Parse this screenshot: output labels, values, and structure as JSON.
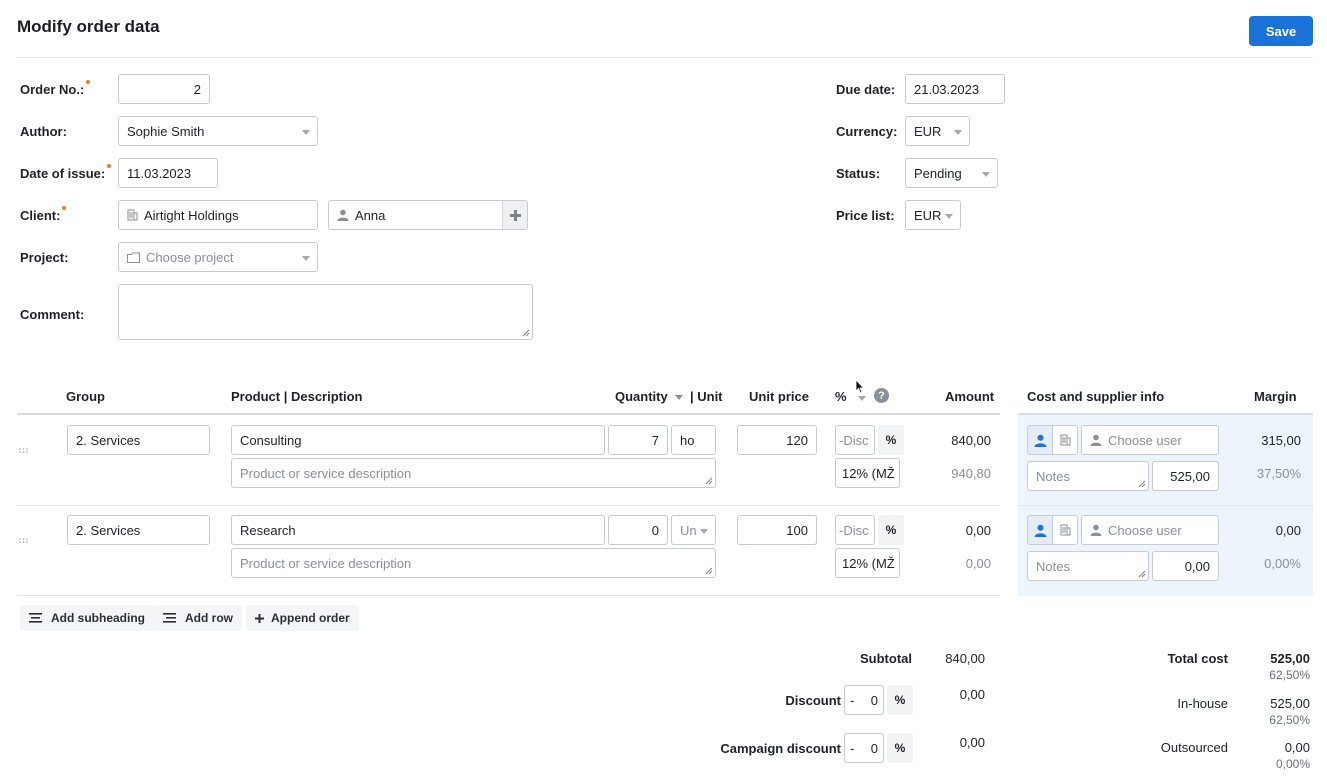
{
  "page": {
    "title": "Modify order data",
    "save_label": "Save"
  },
  "form": {
    "order_no": {
      "label": "Order No.:",
      "value": "2"
    },
    "author": {
      "label": "Author:",
      "value": "Sophie Smith"
    },
    "date_of_issue": {
      "label": "Date of issue:",
      "value": "11.03.2023"
    },
    "client": {
      "label": "Client:",
      "company": "Airtight Holdings",
      "contact": "Anna"
    },
    "project": {
      "label": "Project:",
      "placeholder": "Choose project"
    },
    "comment": {
      "label": "Comment:",
      "value": ""
    },
    "due_date": {
      "label": "Due date:",
      "value": "21.03.2023"
    },
    "currency": {
      "label": "Currency:",
      "value": "EUR"
    },
    "status": {
      "label": "Status:",
      "value": "Pending"
    },
    "price_list": {
      "label": "Price list:",
      "value": "EUR"
    }
  },
  "table": {
    "headers": {
      "group": "Group",
      "product": "Product | Description",
      "quantity": "Quantity",
      "unit": "| Unit",
      "unit_price": "Unit price",
      "pct": "%",
      "amount": "Amount",
      "cost": "Cost and supplier info",
      "margin": "Margin"
    },
    "rows": [
      {
        "group": "2. Services",
        "product": "Consulting",
        "description_placeholder": "Product or service description",
        "quantity": "7",
        "unit": "ho",
        "unit_price": "120",
        "discount_placeholder": "-Disc",
        "pct_symbol": "%",
        "vat": "12% (MŽ",
        "amount": "840,00",
        "amount_gross": "940,80",
        "user_placeholder": "Choose user",
        "notes_placeholder": "Notes",
        "cost": "525,00",
        "margin": "315,00",
        "margin_pct": "37,50%"
      },
      {
        "group": "2. Services",
        "product": "Research",
        "description_placeholder": "Product or service description",
        "quantity": "0",
        "unit": "Un",
        "unit_price": "100",
        "discount_placeholder": "-Disc",
        "pct_symbol": "%",
        "vat": "12% (MŽ",
        "amount": "0,00",
        "amount_gross": "0,00",
        "user_placeholder": "Choose user",
        "notes_placeholder": "Notes",
        "cost": "0,00",
        "margin": "0,00",
        "margin_pct": "0,00%"
      }
    ]
  },
  "actions": {
    "add_subheading": "Add subheading",
    "add_row": "Add row",
    "append_order": "Append order"
  },
  "totals": {
    "subtotal_label": "Subtotal",
    "subtotal": "840,00",
    "discount_label": "Discount",
    "discount_sign": "-",
    "discount_value": "0",
    "discount_pct": "%",
    "discount_amount": "0,00",
    "campaign_label": "Campaign discount",
    "campaign_sign": "-",
    "campaign_value": "0",
    "campaign_pct": "%",
    "campaign_amount": "0,00"
  },
  "cost_totals": {
    "total_cost_label": "Total cost",
    "total_cost": "525,00",
    "total_cost_pct": "62,50%",
    "inhouse_label": "In-house",
    "inhouse": "525,00",
    "inhouse_pct": "62,50%",
    "outsourced_label": "Outsourced",
    "outsourced": "0,00",
    "outsourced_pct": "0,00%"
  },
  "colors": {
    "accent": "#1a73d9",
    "required": "#f07c2b",
    "cost_panel": "#eef4fb"
  }
}
